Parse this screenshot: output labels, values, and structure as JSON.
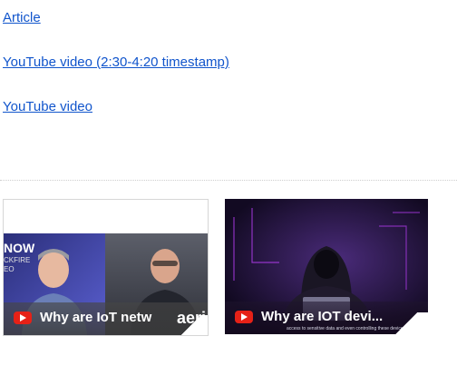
{
  "links": [
    {
      "label": "Article"
    },
    {
      "label": "YouTube video (2:30-4:20 timestamp)"
    },
    {
      "label": "YouTube video"
    }
  ],
  "videos": [
    {
      "title": "Why are IoT netw",
      "brand_left": "NOW",
      "brand_left_sub": "CKFIRE",
      "brand_left_sub2": "EO",
      "brand_right": "aeri",
      "icon": "youtube-icon"
    },
    {
      "title": "Why are IOT devi...",
      "caption": "access to sensitive data and even controlling these devices.",
      "icon": "youtube-icon"
    }
  ],
  "colors": {
    "link": "#1155cc",
    "youtube_red": "#e62117",
    "divider": "#cfcfcf"
  }
}
